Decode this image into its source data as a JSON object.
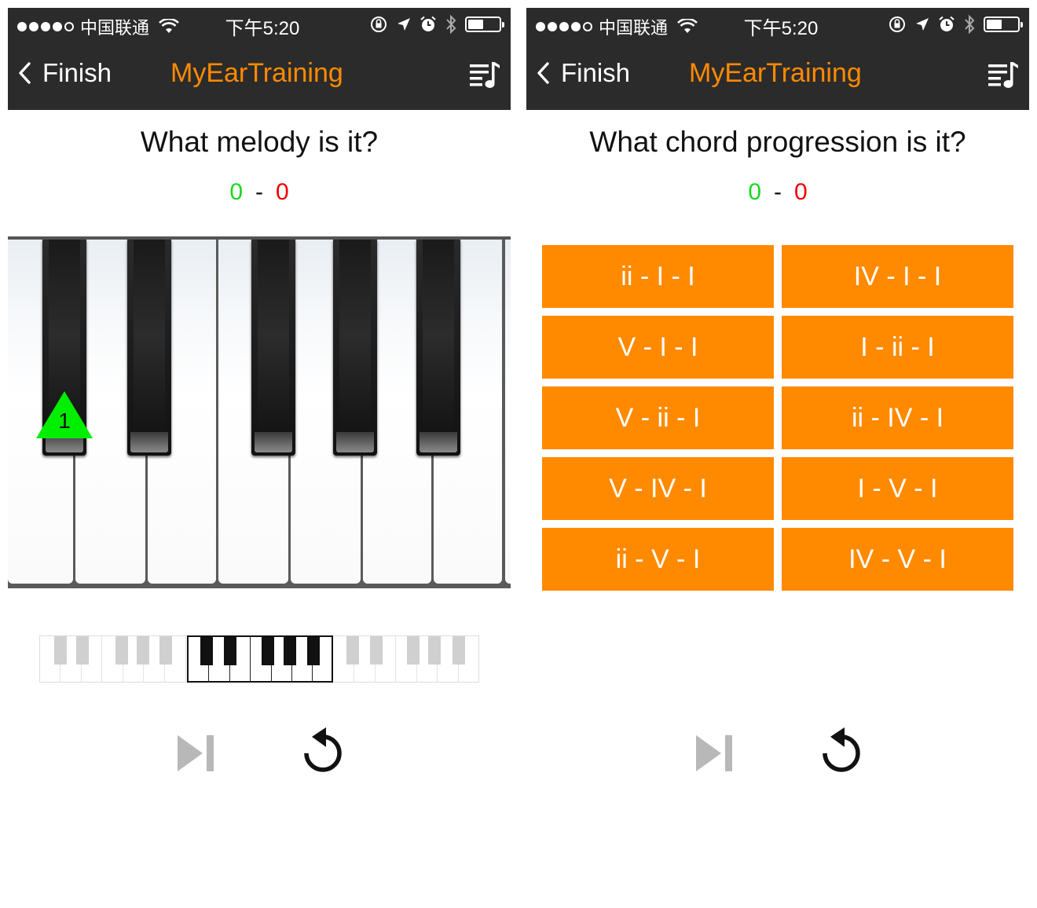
{
  "status_bar": {
    "carrier": "中国联通",
    "time": "下午5:20",
    "battery_level": 0.45
  },
  "nav": {
    "back_label": "Finish",
    "title": "MyEarTraining"
  },
  "screens": {
    "melody": {
      "question": "What melody is it?",
      "score": {
        "correct": "0",
        "separator": "-",
        "wrong": "0"
      },
      "note_marker": "1"
    },
    "chord": {
      "question": "What chord progression is it?",
      "score": {
        "correct": "0",
        "separator": "-",
        "wrong": "0"
      },
      "options": [
        "ii - I - I",
        "IV - I - I",
        "V - I - I",
        "I - ii - I",
        "V - ii - I",
        "ii - IV - I",
        "V - IV - I",
        "I - V - I",
        "ii - V - I",
        "IV - V - I"
      ]
    }
  },
  "icons": {
    "back": "chevron-left-icon",
    "playlist": "playlist-music-icon",
    "next": "skip-next-icon",
    "replay": "replay-icon",
    "wifi": "wifi-icon",
    "rotation_lock": "rotation-lock-icon",
    "location": "location-arrow-icon",
    "alarm": "alarm-icon",
    "bluetooth": "bluetooth-icon",
    "battery": "battery-icon"
  },
  "colors": {
    "accent": "#ff8a00",
    "bar_bg": "#2b2b2b",
    "correct": "#19d81f",
    "wrong": "#ee0000",
    "marker": "#00ee00"
  }
}
